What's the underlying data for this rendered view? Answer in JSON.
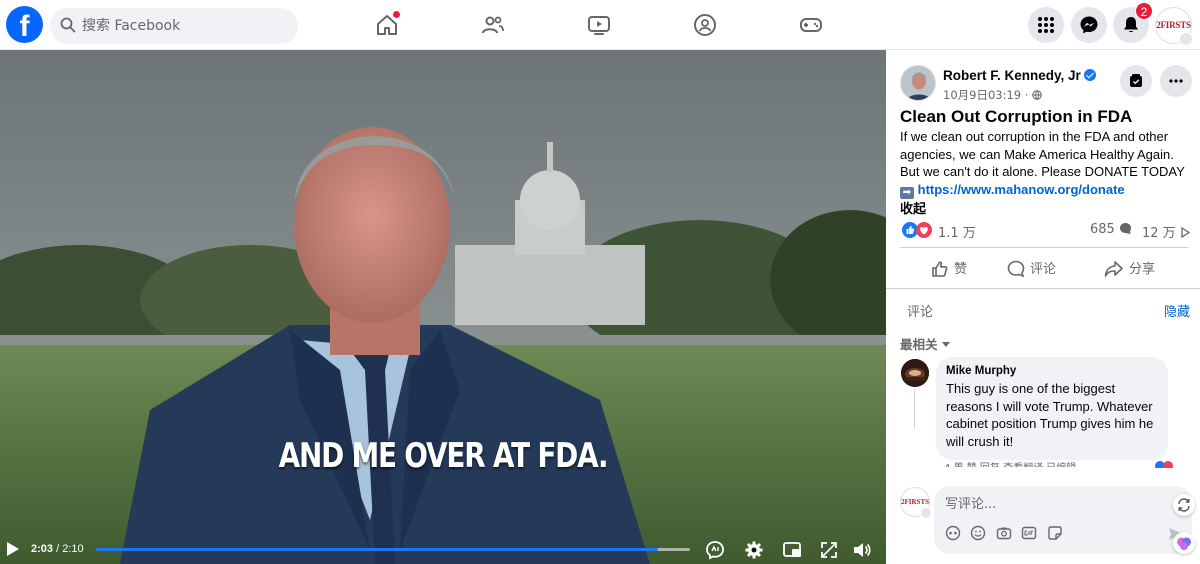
{
  "topbar": {
    "logo_letter": "f",
    "search_placeholder": "搜索 Facebook",
    "notifications_count": "2",
    "profile_initials": "2FIRSTS"
  },
  "video": {
    "caption": "AND ME OVER AT FDA.",
    "current_time": "2:03",
    "duration": "/ 2:10",
    "progress_fraction": 0.946
  },
  "post": {
    "author": "Robert F. Kennedy, Jr",
    "date": "10月9日03:19 · ",
    "title": "Clean Out Corruption in FDA",
    "body_text": "If we clean out corruption in the FDA and other agencies, we can Make America Healthy Again. But we can't do it alone. Please DONATE TODAY ",
    "arrow_glyph": "➡",
    "link_text": "https://www.mahanow.org/donate",
    "collapse_label": "收起",
    "reaction_count": "1.1 万",
    "comment_count": "685",
    "share_count": "12 万"
  },
  "actions": {
    "like": "赞",
    "comment": "评论",
    "share": "分享"
  },
  "comments": {
    "label": "评论",
    "hide_label": "隐藏",
    "sort_label": "最相关",
    "items": [
      {
        "name": "Mike Murphy",
        "text": "This guy is one of the biggest reasons I will vote Trump. Whatever cabinet position Trump gives him he will crush it!",
        "meta": "4 周    赞    回复    查看翻译    已编辑"
      }
    ],
    "composer_placeholder": "写评论..."
  },
  "colors": {
    "brand_blue": "#0866ff",
    "link_blue": "#0064d1",
    "notification_red": "#e41e3f"
  }
}
